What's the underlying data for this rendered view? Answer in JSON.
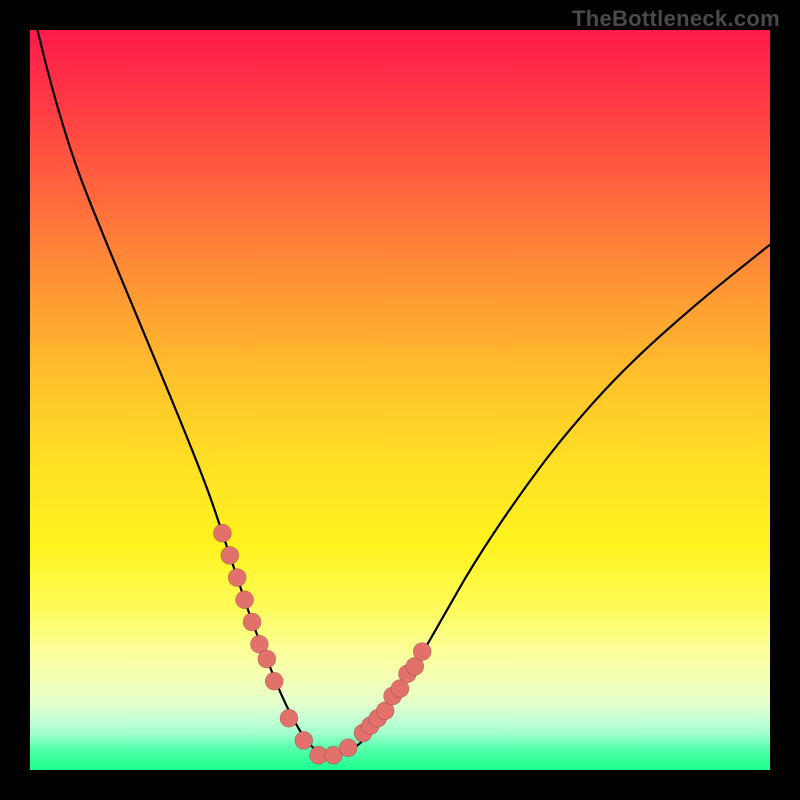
{
  "watermark": "TheBottleneck.com",
  "chart_data": {
    "type": "line",
    "title": "",
    "xlabel": "",
    "ylabel": "",
    "xlim": [
      0,
      100
    ],
    "ylim": [
      0,
      100
    ],
    "grid": false,
    "legend": false,
    "background_gradient": {
      "top": "#ff1a4a",
      "mid": "#ffe324",
      "bottom": "#1aff8e"
    },
    "series": [
      {
        "name": "bottleneck-curve",
        "x": [
          1,
          3,
          6,
          10,
          15,
          20,
          24,
          26,
          28,
          30,
          32,
          34,
          36,
          38,
          40,
          42,
          44,
          46,
          48,
          52,
          56,
          60,
          66,
          72,
          80,
          90,
          100
        ],
        "values": [
          100,
          92,
          82,
          72,
          60,
          48,
          38,
          32,
          26,
          20,
          15,
          10,
          6,
          3,
          2,
          2,
          3,
          5,
          8,
          14,
          21,
          28,
          37,
          45,
          54,
          63,
          71
        ]
      }
    ],
    "markers": {
      "name": "sample-points",
      "color": "#e2716b",
      "x": [
        26,
        27,
        28,
        29,
        30,
        31,
        32,
        33,
        35,
        37,
        39,
        41,
        43,
        45,
        46,
        47,
        48,
        49,
        50,
        51,
        52,
        53
      ],
      "values": [
        32,
        29,
        26,
        23,
        20,
        17,
        15,
        12,
        7,
        4,
        2,
        2,
        3,
        5,
        6,
        7,
        8,
        10,
        11,
        13,
        14,
        16
      ]
    }
  }
}
